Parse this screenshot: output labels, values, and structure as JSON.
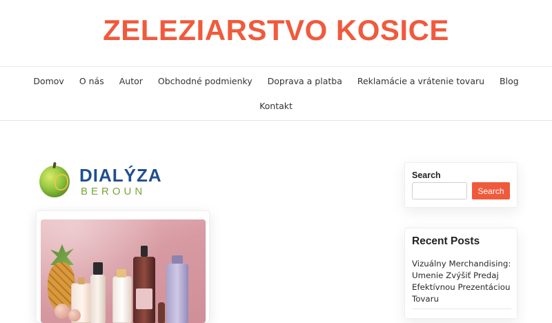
{
  "site": {
    "title": "ZELEZIARSTVO KOSICE"
  },
  "nav": {
    "items": [
      "Domov",
      "O nás",
      "Autor",
      "Obchodné podmienky",
      "Doprava a platba",
      "Reklamácie a vrátenie tovaru",
      "Blog"
    ],
    "second_row": [
      "Kontakt"
    ]
  },
  "logo": {
    "word1": "DIALÝZA",
    "word2": "BEROUN"
  },
  "search": {
    "label": "Search",
    "button": "Search",
    "value": ""
  },
  "recent_posts": {
    "title": "Recent Posts",
    "items": [
      "Vizuálny Merchandising: Umenie Zvýšiť Predaj Efektívnou Prezentáciou Tovaru"
    ]
  },
  "colors": {
    "accent": "#f05a3c",
    "logo_blue": "#1f4f8f",
    "logo_green": "#7aa33a"
  }
}
